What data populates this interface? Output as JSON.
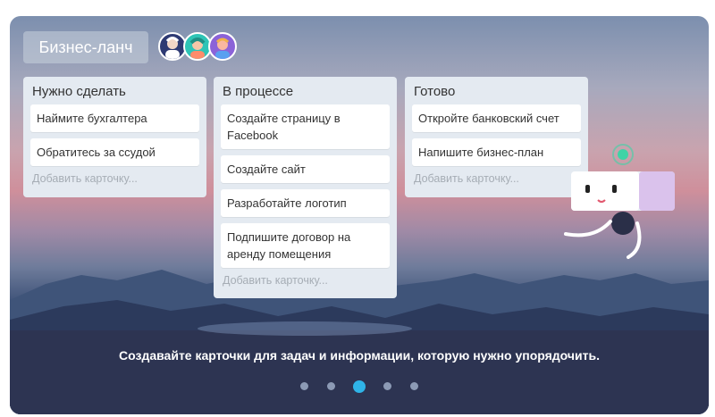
{
  "board": {
    "title": "Бизнес-ланч",
    "avatars": [
      "avatar-1",
      "avatar-2",
      "avatar-3"
    ]
  },
  "lists": [
    {
      "title": "Нужно сделать",
      "cards": [
        "Наймите бухгалтера",
        "Обратитесь за ссудой"
      ],
      "add_card": "Добавить карточку..."
    },
    {
      "title": "В процессе",
      "cards": [
        "Создайте страницу в Facebook",
        "Создайте сайт",
        "Разработайте логотип",
        "Подпишите договор на аренду помещения"
      ],
      "add_card": "Добавить карточку..."
    },
    {
      "title": "Готово",
      "cards": [
        "Откройте банковский счет",
        "Напишите бизнес-план"
      ],
      "add_card": "Добавить карточку..."
    }
  ],
  "caption": "Создавайте карточки для задач и информации, которую нужно упорядочить.",
  "carousel": {
    "total": 5,
    "active": 3
  },
  "colors": {
    "accent": "#2fb4e8",
    "dot": "#8c9ab5",
    "list_bg": "#e4eaf1"
  }
}
